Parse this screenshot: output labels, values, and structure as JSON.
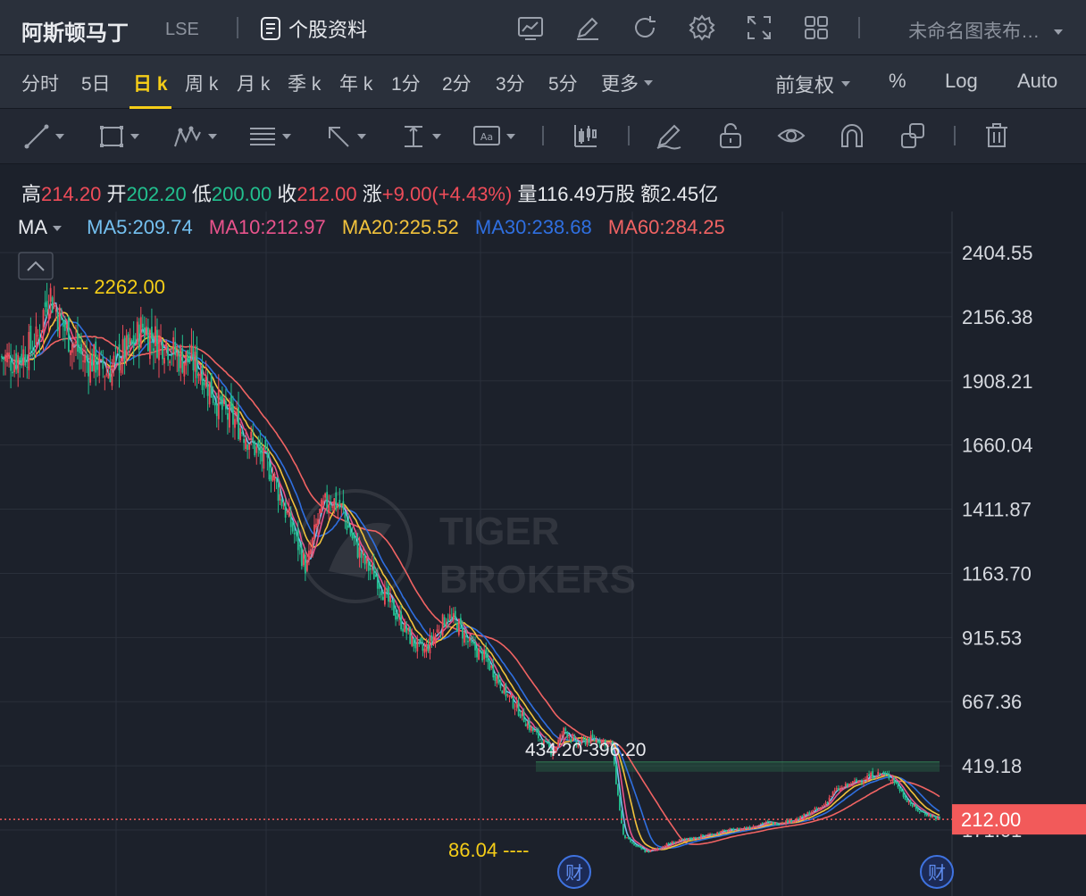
{
  "header": {
    "stock_name": "阿斯顿马丁",
    "exchange": "LSE",
    "profile_label": "个股资料",
    "chart_name": "未命名图表布…"
  },
  "periods": [
    "分时",
    "5日",
    "日 k",
    "周 k",
    "月 k",
    "季 k",
    "年 k",
    "1分",
    "2分",
    "3分",
    "5分",
    "更多"
  ],
  "active_period": "日 k",
  "right_options": {
    "adjust": "前复权",
    "percent": "%",
    "log": "Log",
    "auto": "Auto"
  },
  "ohlc": {
    "high_label": "高",
    "high": "214.20",
    "open_label": "开",
    "open": "202.20",
    "low_label": "低",
    "low": "200.00",
    "close_label": "收",
    "close": "212.00",
    "change_label": "涨",
    "change": "+9.00(+4.43%)",
    "volume_label": "量",
    "volume": "116.49万股",
    "amount_label": "额",
    "amount": "2.45亿"
  },
  "ma": {
    "label": "MA",
    "ma5": "MA5:209.74",
    "ma10": "MA10:212.97",
    "ma20": "MA20:225.52",
    "ma30": "MA30:238.68",
    "ma60": "MA60:284.25"
  },
  "colors": {
    "up": "#ee4c59",
    "down": "#22c08f",
    "ma5": "#74c0f0",
    "ma10": "#e8538c",
    "ma20": "#f2c33c",
    "ma30": "#2f6fe0",
    "ma60": "#f06363",
    "highlight": "#f5cd18",
    "price_tag": "#f25a5a"
  },
  "chart_data": {
    "type": "candlestick",
    "y_ticks": [
      "2404.55",
      "2156.38",
      "1908.21",
      "1660.04",
      "1411.87",
      "1163.70",
      "915.53",
      "667.36",
      "419.18",
      "171.01"
    ],
    "ylim": [
      171.01,
      2404.55
    ],
    "high_annotation": "---- 2262.00",
    "low_annotation": "86.04 ----",
    "range_annotation": "434.20-396.20",
    "range_band": [
      396.2,
      434.2
    ],
    "last_price": "212.00",
    "earnings_marker": "财",
    "close_series": [
      2000,
      1990,
      2020,
      2060,
      2262,
      2140,
      2060,
      1990,
      1985,
      1940,
      2000,
      2030,
      2120,
      2070,
      2060,
      2000,
      1990,
      1950,
      1860,
      1780,
      1750,
      1690,
      1620,
      1560,
      1430,
      1310,
      1180,
      1380,
      1460,
      1410,
      1290,
      1200,
      1150,
      1050,
      980,
      900,
      860,
      930,
      1000,
      960,
      880,
      850,
      780,
      700,
      640,
      570,
      520,
      470,
      560,
      500,
      520,
      520,
      500,
      150,
      110,
      86,
      100,
      120,
      130,
      140,
      150,
      160,
      170,
      175,
      185,
      200,
      195,
      205,
      215,
      240,
      260,
      320,
      340,
      360,
      380,
      390,
      370,
      300,
      250,
      230,
      212
    ]
  }
}
